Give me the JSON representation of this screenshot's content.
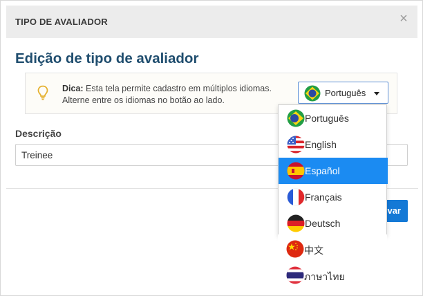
{
  "header": {
    "title": "TIPO DE AVALIADOR",
    "close_symbol": "×"
  },
  "page": {
    "title": "Edição de tipo de avaliador"
  },
  "tip": {
    "label": "Dica:",
    "line1": " Esta tela permite cadastro em múltiplos idiomas.",
    "line2": "Alterne entre os idiomas no botão ao lado."
  },
  "language_selector": {
    "selected": "Português",
    "options": [
      {
        "label": "Português",
        "flag": "brazil-flag-icon"
      },
      {
        "label": "English",
        "flag": "usa-flag-icon"
      },
      {
        "label": "Español",
        "flag": "spain-flag-icon",
        "highlighted": true
      },
      {
        "label": "Français",
        "flag": "france-flag-icon"
      },
      {
        "label": "Deutsch",
        "flag": "germany-flag-icon"
      },
      {
        "label": "中文",
        "flag": "china-flag-icon"
      },
      {
        "label": "ภาษาไทย",
        "flag": "thailand-flag-icon"
      }
    ]
  },
  "form": {
    "description_label": "Descrição",
    "description_value": "Treinee"
  },
  "footer": {
    "save_label": "var"
  },
  "colors": {
    "accent": "#1479d6",
    "highlight": "#1b8bf2",
    "title": "#1f4d6e"
  }
}
